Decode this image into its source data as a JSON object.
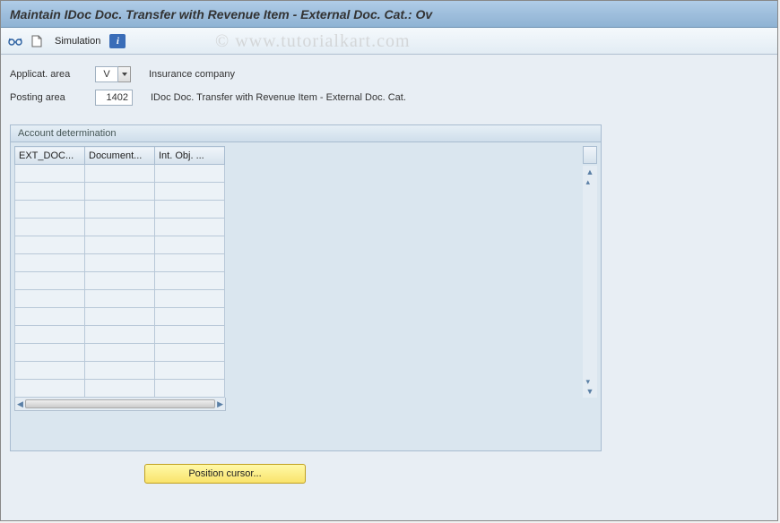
{
  "window": {
    "title": "Maintain IDoc Doc. Transfer with Revenue Item - External Doc. Cat.: Ov"
  },
  "watermark": "© www.tutorialkart.com",
  "toolbar": {
    "simulation_label": "Simulation"
  },
  "fields": {
    "applic_area": {
      "label": "Applicat. area",
      "value": "V",
      "desc": "Insurance company"
    },
    "posting_area": {
      "label": "Posting area",
      "value": "1402",
      "desc": "IDoc Doc. Transfer with Revenue Item - External Doc. Cat."
    }
  },
  "panel": {
    "title": "Account determination"
  },
  "grid": {
    "columns": [
      "EXT_DOC...",
      "Document...",
      "Int. Obj. ..."
    ],
    "rows": 13
  },
  "buttons": {
    "position_cursor": "Position cursor..."
  }
}
